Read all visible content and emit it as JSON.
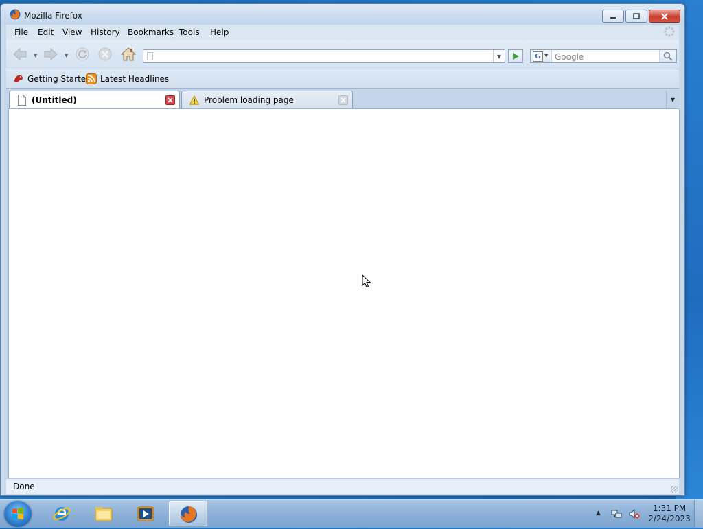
{
  "window": {
    "title": "Mozilla Firefox",
    "app_icon": "firefox-icon"
  },
  "menubar": {
    "items": [
      "File",
      "Edit",
      "View",
      "History",
      "Bookmarks",
      "Tools",
      "Help"
    ]
  },
  "navbar": {
    "url_value": "",
    "search_placeholder": "Google",
    "search_engine_icon": "google-icon"
  },
  "bookmarks": {
    "items": [
      {
        "label": "Getting Started",
        "icon": "getting-started-icon"
      },
      {
        "label": "Latest Headlines",
        "icon": "rss-feed-icon"
      }
    ]
  },
  "tabs": {
    "items": [
      {
        "label": "(Untitled)",
        "icon": "page-icon",
        "active": true
      },
      {
        "label": "Problem loading page",
        "icon": "warning-icon",
        "active": false
      }
    ]
  },
  "status": {
    "text": "Done"
  },
  "taskbar": {
    "pinned": [
      "internet-explorer-icon",
      "file-explorer-icon",
      "media-player-icon",
      "firefox-icon"
    ],
    "time": "1:31 PM",
    "date": "2/24/2023"
  },
  "colors": {
    "accent": "#2b8ad6",
    "chrome": "#c9d9ec"
  }
}
